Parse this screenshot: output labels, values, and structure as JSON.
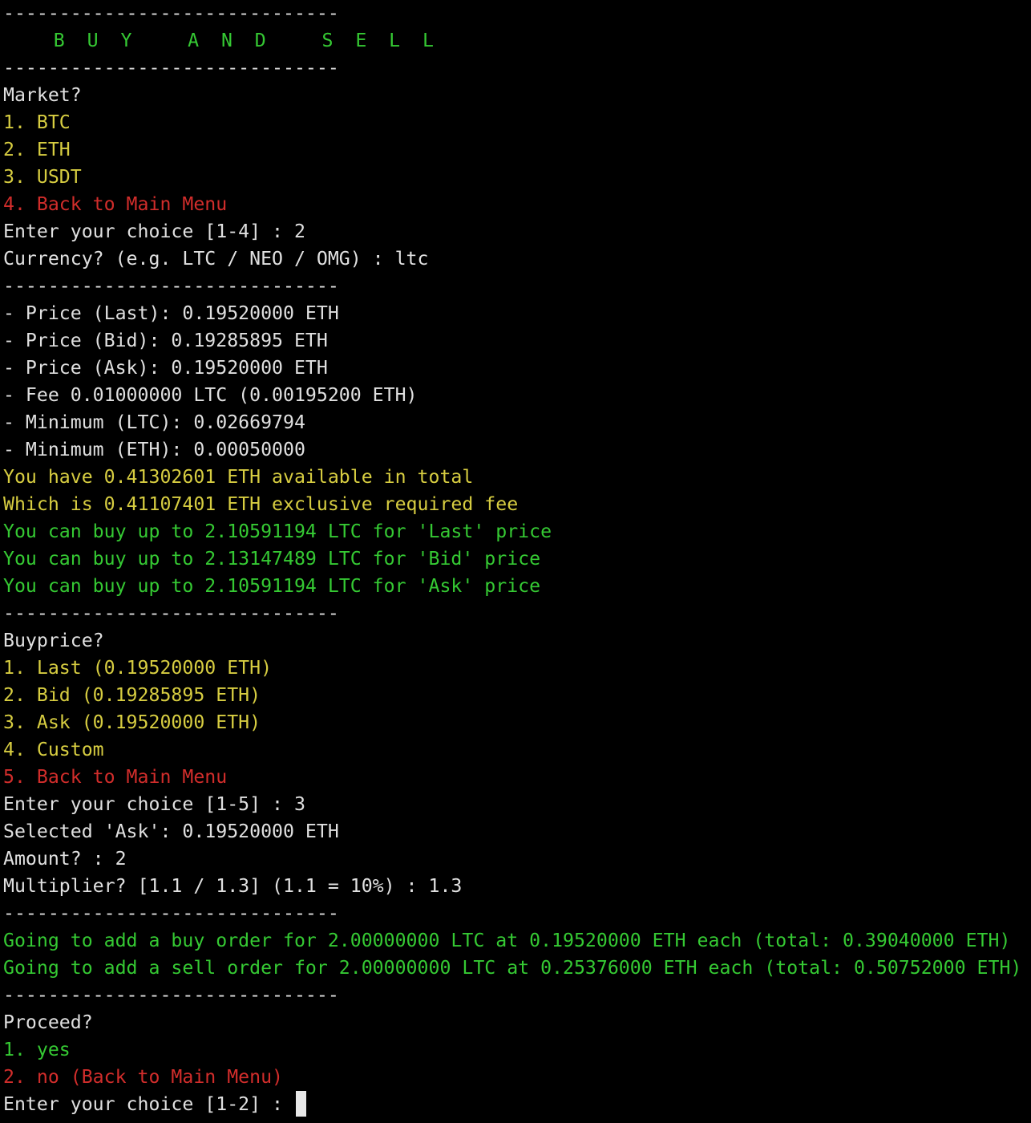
{
  "terminal": {
    "lines": [
      {
        "text": "------------------------------",
        "color": "white",
        "kind": "divider"
      },
      {
        "text": "   B U Y   A N D   S E L L",
        "color": "green",
        "kind": "title"
      },
      {
        "text": "------------------------------",
        "color": "white",
        "kind": "divider"
      },
      {
        "text": "Market?",
        "color": "white",
        "kind": "prompt"
      },
      {
        "text": "1. BTC",
        "color": "yellow",
        "kind": "option"
      },
      {
        "text": "2. ETH",
        "color": "yellow",
        "kind": "option"
      },
      {
        "text": "3. USDT",
        "color": "yellow",
        "kind": "option"
      },
      {
        "text": "4. Back to Main Menu",
        "color": "red",
        "kind": "option"
      },
      {
        "text": "Enter your choice [1-4] : 2",
        "color": "white",
        "kind": "input"
      },
      {
        "text": "Currency? (e.g. LTC / NEO / OMG) : ltc",
        "color": "white",
        "kind": "input"
      },
      {
        "text": "------------------------------",
        "color": "white",
        "kind": "divider"
      },
      {
        "text": "- Price (Last): 0.19520000 ETH",
        "color": "white",
        "kind": "info"
      },
      {
        "text": "- Price (Bid): 0.19285895 ETH",
        "color": "white",
        "kind": "info"
      },
      {
        "text": "- Price (Ask): 0.19520000 ETH",
        "color": "white",
        "kind": "info"
      },
      {
        "text": "- Fee 0.01000000 LTC (0.00195200 ETH)",
        "color": "white",
        "kind": "info"
      },
      {
        "text": "- Minimum (LTC): 0.02669794",
        "color": "white",
        "kind": "info"
      },
      {
        "text": "- Minimum (ETH): 0.00050000",
        "color": "white",
        "kind": "info"
      },
      {
        "text": "You have 0.41302601 ETH available in total",
        "color": "yellow",
        "kind": "info"
      },
      {
        "text": "Which is 0.41107401 ETH exclusive required fee",
        "color": "yellow",
        "kind": "info"
      },
      {
        "text": "You can buy up to 2.10591194 LTC for 'Last' price",
        "color": "green",
        "kind": "info"
      },
      {
        "text": "You can buy up to 2.13147489 LTC for 'Bid' price",
        "color": "green",
        "kind": "info"
      },
      {
        "text": "You can buy up to 2.10591194 LTC for 'Ask' price",
        "color": "green",
        "kind": "info"
      },
      {
        "text": "------------------------------",
        "color": "white",
        "kind": "divider"
      },
      {
        "text": "Buyprice?",
        "color": "white",
        "kind": "prompt"
      },
      {
        "text": "1. Last (0.19520000 ETH)",
        "color": "yellow",
        "kind": "option"
      },
      {
        "text": "2. Bid (0.19285895 ETH)",
        "color": "yellow",
        "kind": "option"
      },
      {
        "text": "3. Ask (0.19520000 ETH)",
        "color": "yellow",
        "kind": "option"
      },
      {
        "text": "4. Custom",
        "color": "yellow",
        "kind": "option"
      },
      {
        "text": "5. Back to Main Menu",
        "color": "red",
        "kind": "option"
      },
      {
        "text": "Enter your choice [1-5] : 3",
        "color": "white",
        "kind": "input"
      },
      {
        "text": "Selected 'Ask': 0.19520000 ETH",
        "color": "white",
        "kind": "info"
      },
      {
        "text": "Amount? : 2",
        "color": "white",
        "kind": "input"
      },
      {
        "text": "Multiplier? [1.1 / 1.3] (1.1 = 10%) : 1.3",
        "color": "white",
        "kind": "input"
      },
      {
        "text": "------------------------------",
        "color": "white",
        "kind": "divider"
      },
      {
        "text": "Going to add a buy order for 2.00000000 LTC at 0.19520000 ETH each (total: 0.39040000 ETH)",
        "color": "green",
        "kind": "info"
      },
      {
        "text": "Going to add a sell order for 2.00000000 LTC at 0.25376000 ETH each (total: 0.50752000 ETH)",
        "color": "green",
        "kind": "info"
      },
      {
        "text": "------------------------------",
        "color": "white",
        "kind": "divider"
      },
      {
        "text": "Proceed?",
        "color": "white",
        "kind": "prompt"
      },
      {
        "text": "1. yes",
        "color": "green",
        "kind": "option"
      },
      {
        "text": "2. no (Back to Main Menu)",
        "color": "red",
        "kind": "option"
      },
      {
        "text": "Enter your choice [1-2] : ",
        "color": "white",
        "kind": "current-input"
      }
    ]
  },
  "colors": {
    "background": "#000000",
    "white": "#e0e0e0",
    "yellow": "#d7cd41",
    "green": "#35c933",
    "red": "#d12d2b",
    "cursor": "#e8e8e8"
  }
}
